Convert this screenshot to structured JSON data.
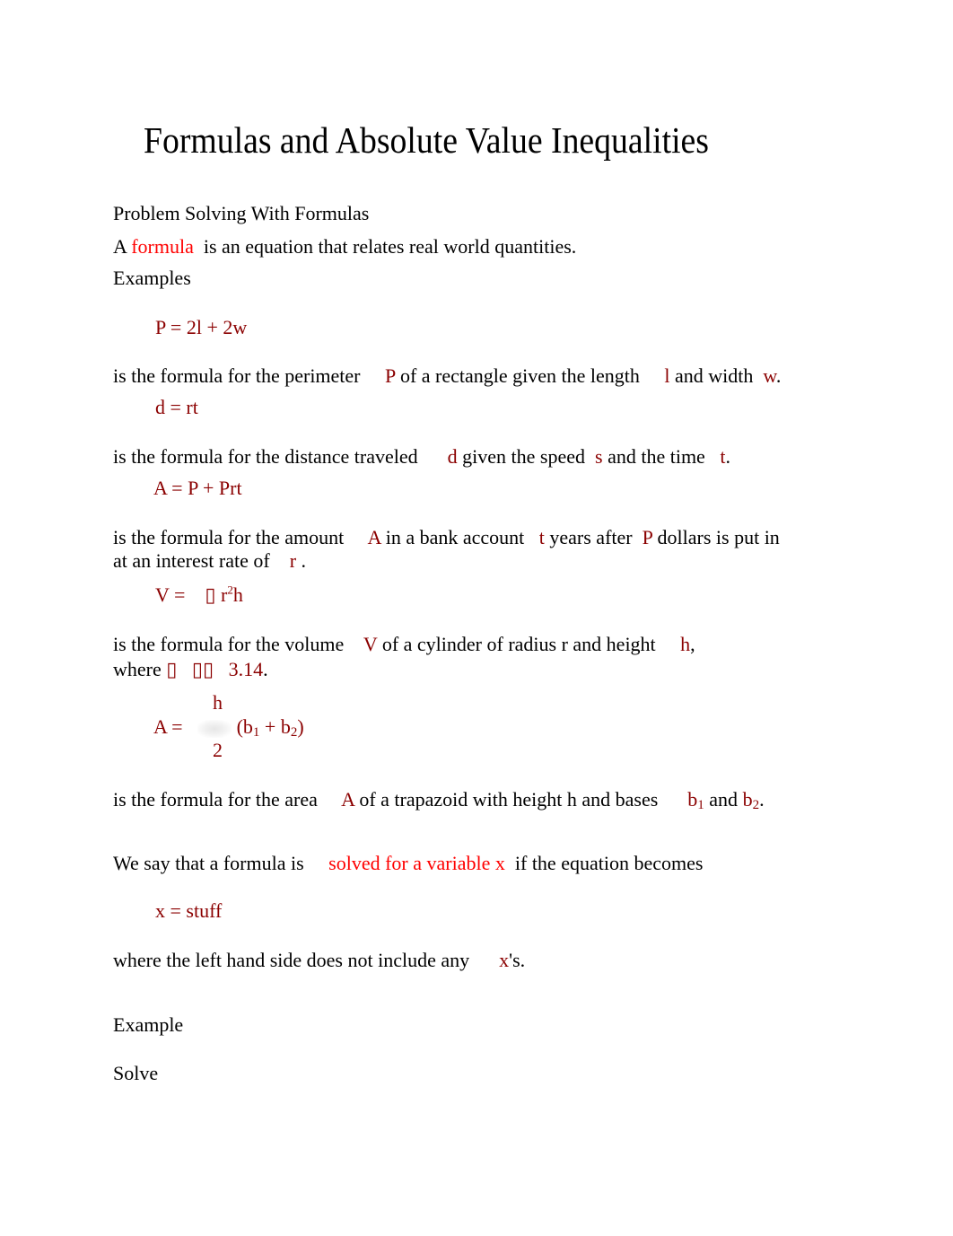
{
  "title": "Formulas and Absolute Value Inequalities",
  "section_heading": "Problem Solving With Formulas",
  "definition": {
    "prefix": "A",
    "term": "formula",
    "suffix": "is an equation that relates real world quantities."
  },
  "examples_label": "Examples",
  "examples": [
    {
      "formula": "P = 2l + 2w",
      "desc": [
        "is the formula for the perimeter",
        "P",
        "of a rectangle given the length",
        "l",
        "and width",
        "w",
        "."
      ]
    },
    {
      "formula": "d = rt",
      "desc": [
        "is the formula for the distance traveled",
        "d",
        "given the speed",
        "s",
        "and the time",
        "t",
        "."
      ]
    },
    {
      "formula": "A = P + Prt",
      "desc": [
        "is the formula for the amount",
        "A",
        "in a bank account",
        "t",
        "years after",
        "P",
        "dollars is put in",
        "at an interest rate of",
        "r",
        "."
      ]
    },
    {
      "formula_prefix": "V =",
      "formula_glyph": "▯",
      "formula_base": "r",
      "formula_exp": "2",
      "formula_tail": "h",
      "desc": [
        "is the formula for the volume",
        "V",
        "of a cylinder of radius r and height",
        "h",
        ",",
        "where",
        "▯",
        "▯▯",
        "3.14",
        "."
      ]
    },
    {
      "formula_lhs": "A =",
      "numerator": "h",
      "denominator": "2",
      "paren_open": "(b",
      "sub1": "1",
      "plus": " + b",
      "sub2": "2",
      "paren_close": ")",
      "desc": [
        "is the formula for the area",
        "A",
        "of a trapazoid with height h and bases",
        "b",
        "1",
        "and",
        "b",
        "2",
        "."
      ]
    }
  ],
  "solved_for": {
    "prefix": "We say that a formula is",
    "term": "solved for a variable x",
    "suffix": "if the equation becomes",
    "formula": "x = stuff",
    "after_prefix": "where the left hand side does not include any",
    "after_var": "x",
    "after_suffix": "'s."
  },
  "example_label": "Example",
  "solve_label": "Solve",
  "colors": {
    "text": "#000000",
    "variable": "#8b0000",
    "highlight": "#ff0000"
  }
}
